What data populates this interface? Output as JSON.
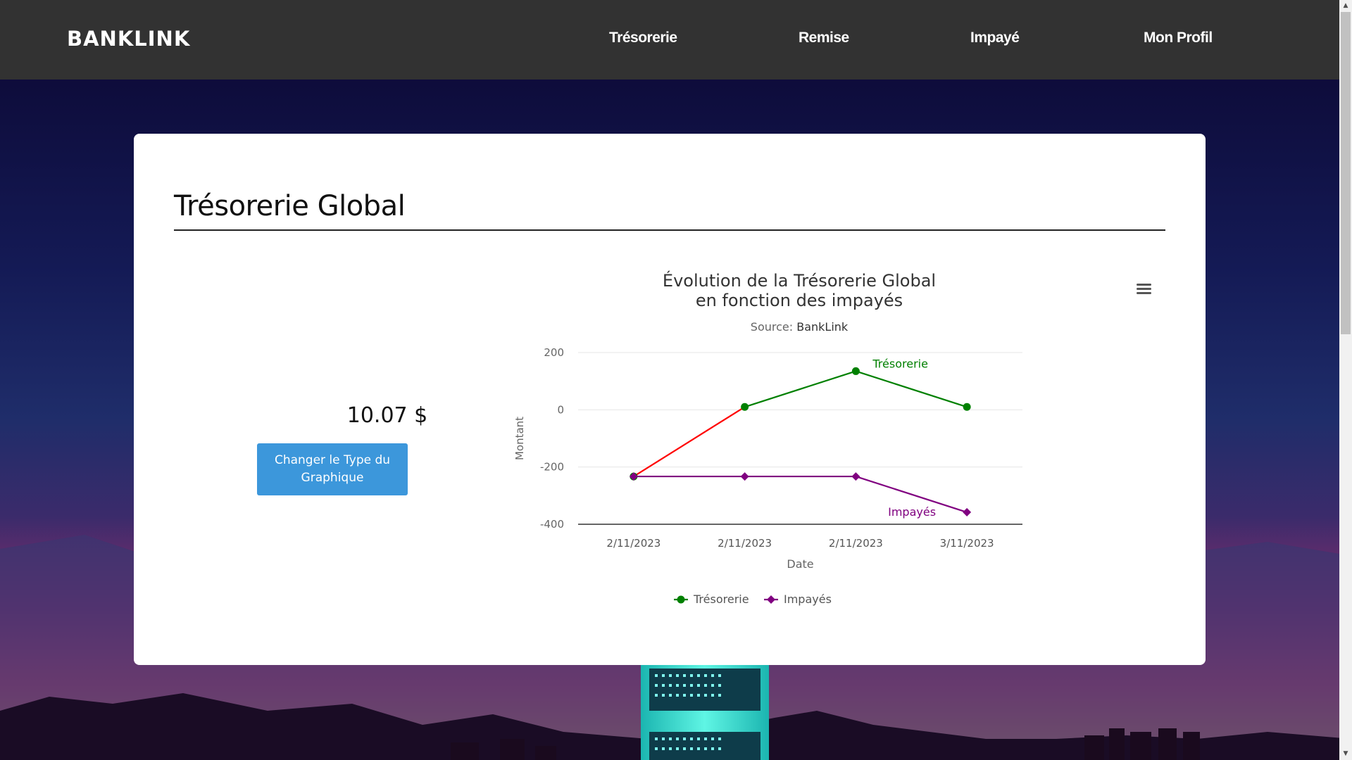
{
  "navbar": {
    "logo": "BANKLINK",
    "links": [
      "Trésorerie",
      "Remise",
      "Impayé",
      "Mon Profil"
    ]
  },
  "card": {
    "title": "Trésorerie Global",
    "amount": "10.07 $",
    "change_button_label": "Changer le Type du Graphique"
  },
  "colors": {
    "navbar": "#323232",
    "button": "#3c97db",
    "tresorerie": "#008000",
    "impayes": "#800080",
    "first_segment": "#ff0000"
  },
  "icons": {
    "menu": "hamburger-icon"
  },
  "chart_data": {
    "type": "line",
    "title_line1": "Évolution de la Trésorerie Global",
    "title_line2": "en fonction des impayés",
    "subtitle_prefix": "Source: ",
    "subtitle_source": "BankLink",
    "xlabel": "Date",
    "ylabel": "Montant",
    "categories": [
      "2/11/2023",
      "2/11/2023",
      "2/11/2023",
      "3/11/2023"
    ],
    "yticks": [
      200,
      0,
      -200,
      -400
    ],
    "ylim": [
      -400,
      200
    ],
    "grid": true,
    "legend_position": "bottom-center",
    "series": [
      {
        "name": "Trésorerie",
        "marker": "circle",
        "color": "#008000",
        "values": [
          -233,
          10,
          135,
          10
        ],
        "label_point": 2
      },
      {
        "name": "Impayés",
        "marker": "diamond",
        "color": "#800080",
        "values": [
          -233,
          -233,
          -233,
          -358
        ],
        "label_point": 3
      }
    ]
  }
}
